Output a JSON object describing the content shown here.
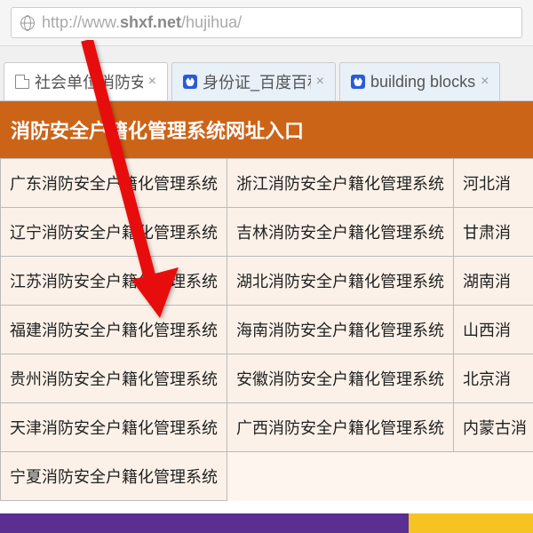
{
  "address_bar": {
    "url_prefix": "http://www.",
    "url_bold": "shxf.net",
    "url_suffix": "/hujihua/"
  },
  "tabs": [
    {
      "title": "社会单位消防安",
      "favicon": "page",
      "active": true
    },
    {
      "title": "身份证_百度百科",
      "favicon": "baidu",
      "active": false
    },
    {
      "title": "building blocks",
      "favicon": "baidu",
      "active": false
    }
  ],
  "section": {
    "header": "消防安全户籍化管理系统网址入口"
  },
  "table": {
    "rows": [
      [
        "广东消防安全户籍化管理系统",
        "浙江消防安全户籍化管理系统",
        "河北消"
      ],
      [
        "辽宁消防安全户籍化管理系统",
        "吉林消防安全户籍化管理系统",
        "甘肃消"
      ],
      [
        "江苏消防安全户籍化管理系统",
        "湖北消防安全户籍化管理系统",
        "湖南消"
      ],
      [
        "福建消防安全户籍化管理系统",
        "海南消防安全户籍化管理系统",
        "山西消"
      ],
      [
        "贵州消防安全户籍化管理系统",
        "安徽消防安全户籍化管理系统",
        "北京消"
      ],
      [
        "天津消防安全户籍化管理系统",
        "广西消防安全户籍化管理系统",
        "内蒙古消"
      ],
      [
        "宁夏消防安全户籍化管理系统",
        "",
        ""
      ]
    ]
  }
}
